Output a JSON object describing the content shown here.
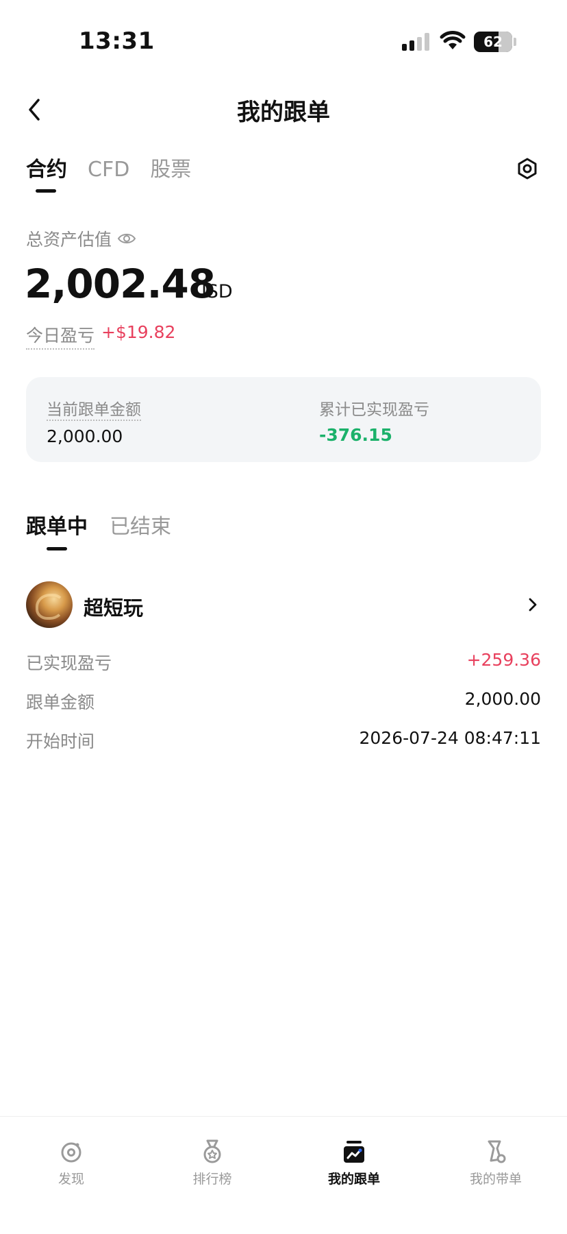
{
  "status_bar": {
    "time": "13:31",
    "battery": "62"
  },
  "nav": {
    "title": "我的跟单"
  },
  "tabs": [
    {
      "label": "合约",
      "active": true
    },
    {
      "label": "CFD",
      "active": false
    },
    {
      "label": "股票",
      "active": false
    }
  ],
  "assets": {
    "label": "总资产估值",
    "value": "2,002.48",
    "unit": "USD",
    "pnl_label": "今日盈亏",
    "pnl_value": "+$19.82"
  },
  "summary": {
    "current_label": "当前跟单金额",
    "current_value": "2,000.00",
    "realized_label": "累计已实现盈亏",
    "realized_value": "-376.15"
  },
  "follow_tabs": [
    {
      "label": "跟单中",
      "active": true
    },
    {
      "label": "已结束",
      "active": false
    }
  ],
  "trader": {
    "name": "超短玩",
    "rows": [
      {
        "label": "已实现盈亏",
        "value": "+259.36"
      },
      {
        "label": "跟单金额",
        "value": "2,000.00"
      },
      {
        "label": "开始时间",
        "value": "2026-07-24 08:47:11"
      }
    ]
  },
  "bottom_nav": [
    {
      "label": "发现",
      "icon": "discover-icon"
    },
    {
      "label": "排行榜",
      "icon": "ranking-medal-icon"
    },
    {
      "label": "我的跟单",
      "icon": "my-copy-trades-icon",
      "active": true
    },
    {
      "label": "我的带单",
      "icon": "my-lead-trades-icon"
    }
  ],
  "colors": {
    "positive": "#e8405d",
    "negative": "#1bb16a",
    "card_bg": "#f3f5f7"
  }
}
